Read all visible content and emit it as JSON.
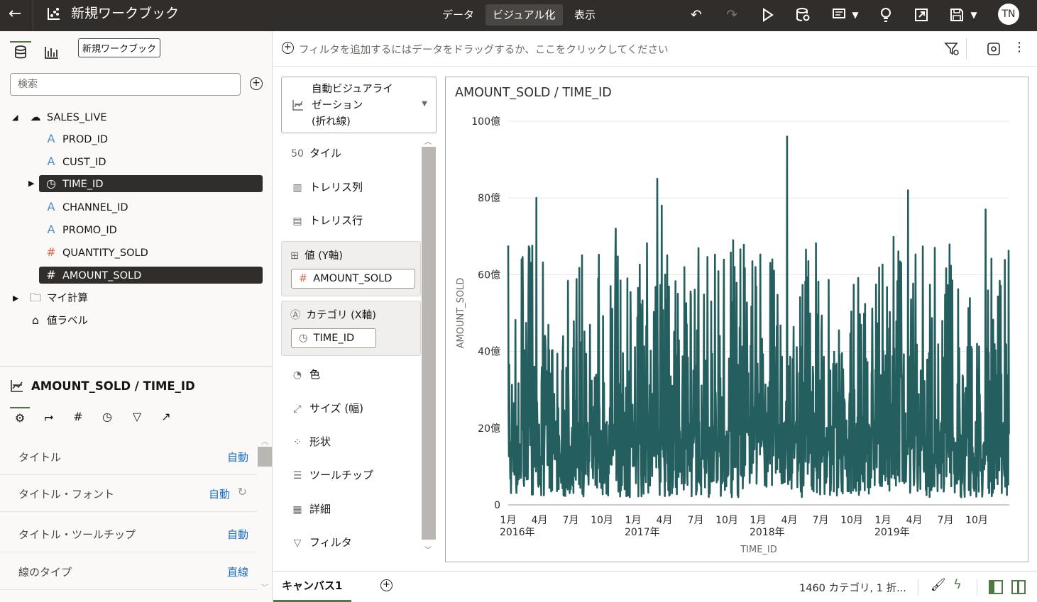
{
  "topbar": {
    "title": "新規ワークブック",
    "nav": [
      "データ",
      "ビジュアル化",
      "表示"
    ],
    "active_nav": "ビジュアル化",
    "user_initials": "TN"
  },
  "left": {
    "tooltip": "新規ワークブック",
    "search_placeholder": "検索",
    "source": "SALES_LIVE",
    "columns": [
      {
        "name": "PROD_ID",
        "type": "A"
      },
      {
        "name": "CUST_ID",
        "type": "A"
      },
      {
        "name": "TIME_ID",
        "type": "clock"
      },
      {
        "name": "CHANNEL_ID",
        "type": "A"
      },
      {
        "name": "PROMO_ID",
        "type": "A"
      },
      {
        "name": "QUANTITY_SOLD",
        "type": "#"
      },
      {
        "name": "AMOUNT_SOLD",
        "type": "#"
      }
    ],
    "my_calc": "マイ計算",
    "value_label": "値ラベル"
  },
  "properties": {
    "title": "AMOUNT_SOLD / TIME_ID",
    "rows": [
      {
        "label": "タイトル",
        "value": "自動"
      },
      {
        "label": "タイトル・フォント",
        "value": "自動"
      },
      {
        "label": "タイトル・ツールチップ",
        "value": "自動"
      },
      {
        "label": "線のタイプ",
        "value": "直線"
      }
    ]
  },
  "filterbar": {
    "text": "フィルタを追加するにはデータをドラッグするか、ここをクリックしてください"
  },
  "grammar": {
    "viz_type": [
      "自動ビジュアライ",
      "ゼーション",
      "(折れ線)"
    ],
    "items_top": [
      {
        "label": "タイル",
        "icon": "50"
      },
      {
        "label": "トレリス列",
        "icon": "▥"
      },
      {
        "label": "トレリス行",
        "icon": "▤"
      }
    ],
    "values_label": "値 (Y軸)",
    "values_pill": "AMOUNT_SOLD",
    "category_label": "カテゴリ (X軸)",
    "category_pill": "TIME_ID",
    "items_bottom": [
      {
        "label": "色",
        "icon": "◔"
      },
      {
        "label": "サイズ (幅)",
        "icon": "⤢"
      },
      {
        "label": "形状",
        "icon": "⁘"
      },
      {
        "label": "ツールチップ",
        "icon": "☰"
      },
      {
        "label": "詳細",
        "icon": "▦"
      },
      {
        "label": "フィルタ",
        "icon": "▽"
      }
    ]
  },
  "canvas_tab": "キャンバス1",
  "status": "1460 カテゴリ, 1 折...",
  "colors": {
    "line": "#245e5f",
    "topbar": "#312d2a",
    "accent": "#4f7842"
  },
  "chart_data": {
    "type": "line",
    "title": "AMOUNT_SOLD / TIME_ID",
    "xlabel": "TIME_ID",
    "ylabel": "AMOUNT_SOLD",
    "ylim": [
      0,
      100
    ],
    "y_ticks": [
      "0",
      "20億",
      "40億",
      "60億",
      "80億",
      "100億"
    ],
    "x_ticks": [
      {
        "label": "1月",
        "year": "2016年"
      },
      {
        "label": "4月",
        "year": ""
      },
      {
        "label": "7月",
        "year": ""
      },
      {
        "label": "10月",
        "year": ""
      },
      {
        "label": "1月",
        "year": "2017年"
      },
      {
        "label": "4月",
        "year": ""
      },
      {
        "label": "7月",
        "year": ""
      },
      {
        "label": "10月",
        "year": ""
      },
      {
        "label": "1月",
        "year": "2018年"
      },
      {
        "label": "4月",
        "year": ""
      },
      {
        "label": "7月",
        "year": ""
      },
      {
        "label": "10月",
        "year": ""
      },
      {
        "label": "1月",
        "year": "2019年"
      },
      {
        "label": "4月",
        "year": ""
      },
      {
        "label": "7月",
        "year": ""
      },
      {
        "label": "10月",
        "year": ""
      }
    ],
    "points": 1460,
    "peaks": [
      {
        "x": "2016-02",
        "y": 64
      },
      {
        "x": "2016-03",
        "y": 80
      },
      {
        "x": "2016-11",
        "y": 72
      },
      {
        "x": "2017-03",
        "y": 78
      },
      {
        "x": "2017-03",
        "y": 85
      },
      {
        "x": "2017-12",
        "y": 62
      },
      {
        "x": "2018-02",
        "y": 64
      },
      {
        "x": "2018-03",
        "y": 96
      },
      {
        "x": "2019-03",
        "y": 82
      },
      {
        "x": "2019-10",
        "y": 77
      }
    ],
    "grid": true,
    "line_color": "#245e5f"
  }
}
